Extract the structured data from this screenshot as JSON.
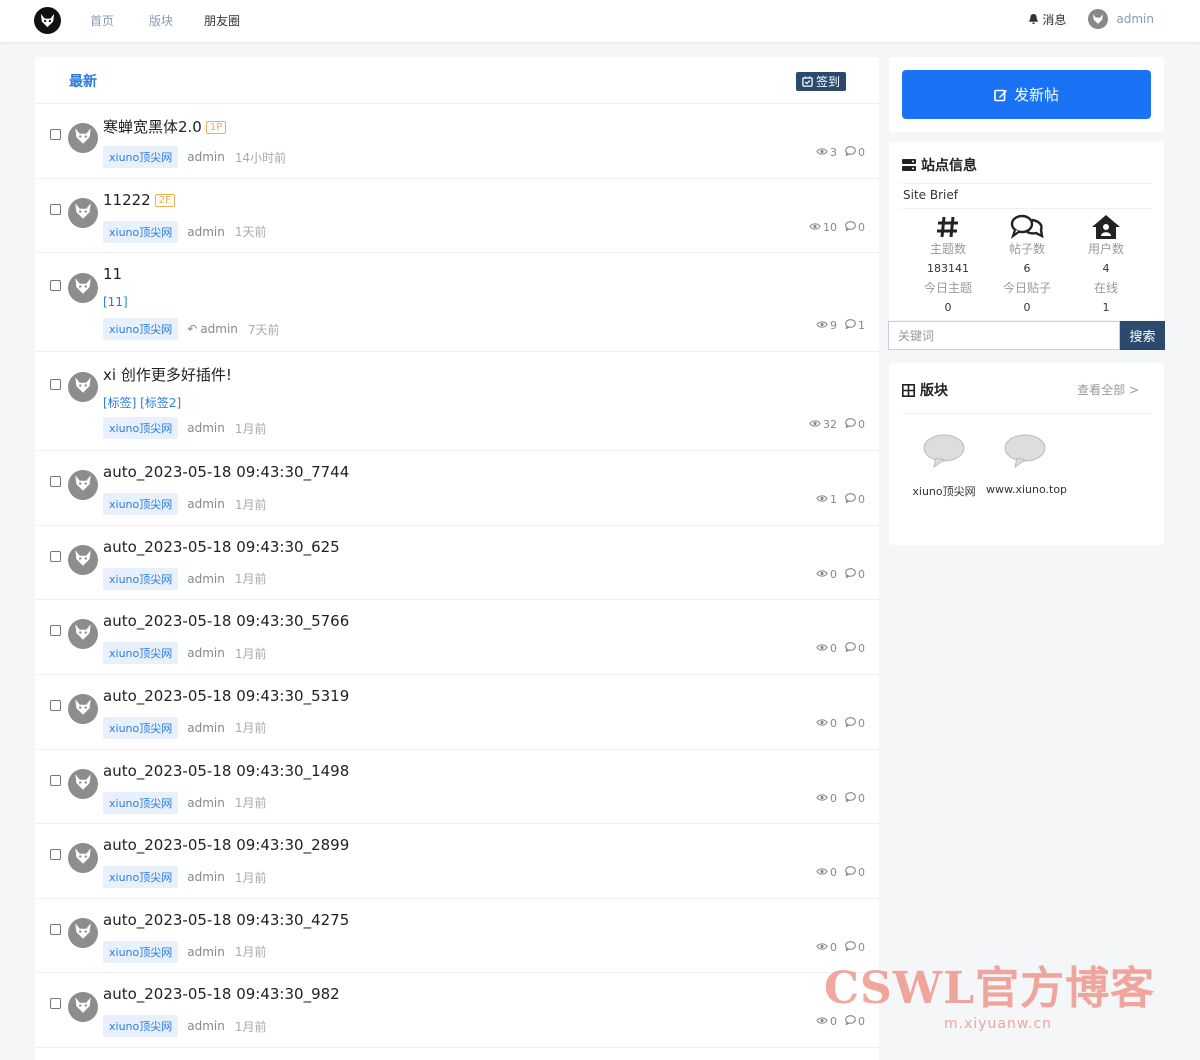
{
  "nav": {
    "items": [
      "首页",
      "版块",
      "朋友圈"
    ],
    "messages": "消息",
    "user": "admin"
  },
  "main": {
    "tab": "最新",
    "checkin": "签到"
  },
  "threads": [
    {
      "title": "寒蝉宽黑体2.0",
      "badge": "1P",
      "tags": "",
      "forum": "xiuno顶尖网",
      "author": "admin",
      "time": "14小时前",
      "views": "3",
      "replies": "0",
      "reply_arrow": false
    },
    {
      "title": "11222",
      "badge": "2F",
      "tags": "",
      "forum": "xiuno顶尖网",
      "author": "admin",
      "time": "1天前",
      "views": "10",
      "replies": "0",
      "reply_arrow": false
    },
    {
      "title": "11",
      "badge": "",
      "tags": "[11]",
      "forum": "xiuno顶尖网",
      "author": "admin",
      "time": "7天前",
      "views": "9",
      "replies": "1",
      "reply_arrow": true
    },
    {
      "title": "xi        创作更多好插件!",
      "badge": "",
      "tags": "[标签] [标签2]",
      "forum": "xiuno顶尖网",
      "author": "admin",
      "time": "1月前",
      "views": "32",
      "replies": "0",
      "reply_arrow": false
    },
    {
      "title": "auto_2023-05-18 09:43:30_7744",
      "badge": "",
      "tags": "",
      "forum": "xiuno顶尖网",
      "author": "admin",
      "time": "1月前",
      "views": "1",
      "replies": "0",
      "reply_arrow": false
    },
    {
      "title": "auto_2023-05-18 09:43:30_625",
      "badge": "",
      "tags": "",
      "forum": "xiuno顶尖网",
      "author": "admin",
      "time": "1月前",
      "views": "0",
      "replies": "0",
      "reply_arrow": false
    },
    {
      "title": "auto_2023-05-18 09:43:30_5766",
      "badge": "",
      "tags": "",
      "forum": "xiuno顶尖网",
      "author": "admin",
      "time": "1月前",
      "views": "0",
      "replies": "0",
      "reply_arrow": false
    },
    {
      "title": "auto_2023-05-18 09:43:30_5319",
      "badge": "",
      "tags": "",
      "forum": "xiuno顶尖网",
      "author": "admin",
      "time": "1月前",
      "views": "0",
      "replies": "0",
      "reply_arrow": false
    },
    {
      "title": "auto_2023-05-18 09:43:30_1498",
      "badge": "",
      "tags": "",
      "forum": "xiuno顶尖网",
      "author": "admin",
      "time": "1月前",
      "views": "0",
      "replies": "0",
      "reply_arrow": false
    },
    {
      "title": "auto_2023-05-18 09:43:30_2899",
      "badge": "",
      "tags": "",
      "forum": "xiuno顶尖网",
      "author": "admin",
      "time": "1月前",
      "views": "0",
      "replies": "0",
      "reply_arrow": false
    },
    {
      "title": "auto_2023-05-18 09:43:30_4275",
      "badge": "",
      "tags": "",
      "forum": "xiuno顶尖网",
      "author": "admin",
      "time": "1月前",
      "views": "0",
      "replies": "0",
      "reply_arrow": false
    },
    {
      "title": "auto_2023-05-18 09:43:30_982",
      "badge": "",
      "tags": "",
      "forum": "xiuno顶尖网",
      "author": "admin",
      "time": "1月前",
      "views": "0",
      "replies": "0",
      "reply_arrow": false
    }
  ],
  "sidebar": {
    "new_post": "发新帖",
    "site_info": {
      "title": "站点信息",
      "brief": "Site Brief",
      "stats": [
        {
          "label": "主题数",
          "value": "183141",
          "label2": "今日主题",
          "value2": "0"
        },
        {
          "label": "帖子数",
          "value": "6",
          "label2": "今日贴子",
          "value2": "0"
        },
        {
          "label": "用户数",
          "value": "4",
          "label2": "在线",
          "value2": "1"
        }
      ]
    },
    "search": {
      "placeholder": "关键词",
      "button": "搜索"
    },
    "forums": {
      "title": "版块",
      "view_all": "查看全部 >",
      "items": [
        "xiuno顶尖网",
        "www.xiuno.top"
      ]
    }
  },
  "watermark": {
    "main": "CSWL官方博客",
    "sub": "m.xiyuanw.cn"
  },
  "colors": {
    "accent": "#1a73f5",
    "link": "#2a7ae2",
    "dark_button": "#2b4a6e",
    "badge": "#f0ad4e"
  }
}
